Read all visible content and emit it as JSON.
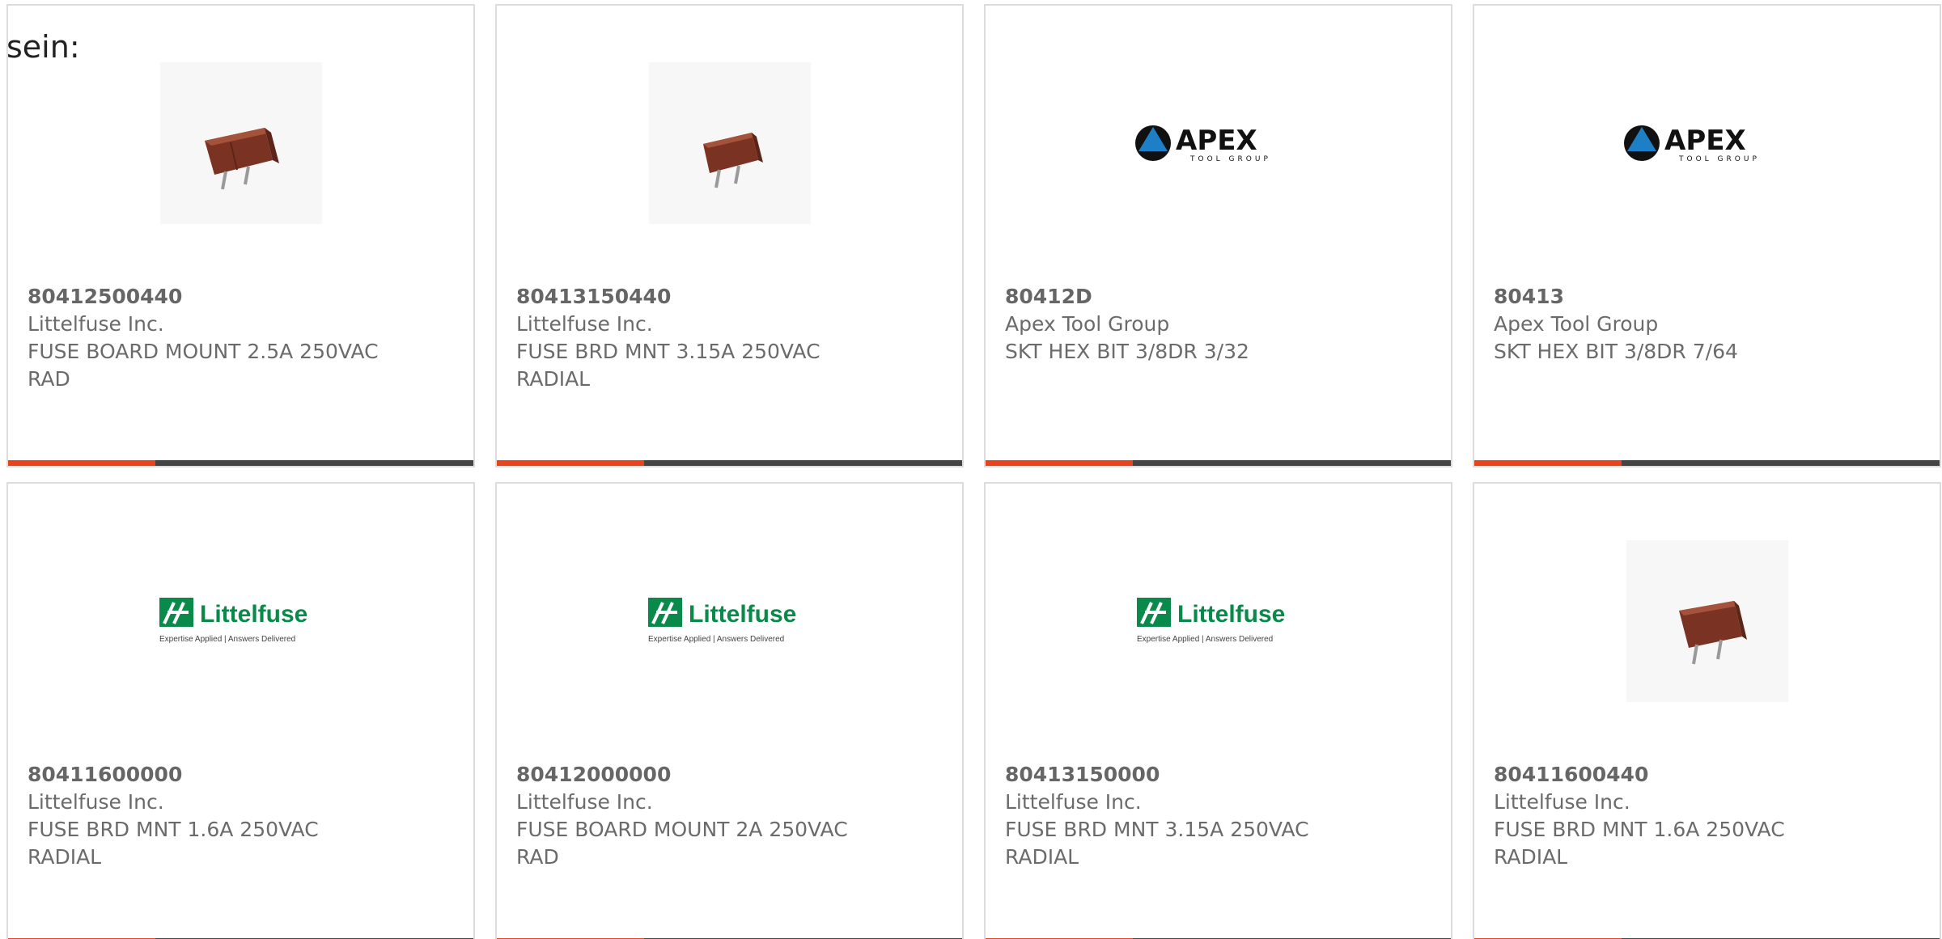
{
  "lead_text": "sein:",
  "colors": {
    "accent_bar": "#e8431b",
    "bar": "#444444",
    "fuse_body": "#8a3a28",
    "apex_blue": "#1d7fc6",
    "littelfuse_green": "#0a8a4a"
  },
  "products": [
    {
      "part_number": "80412500440",
      "manufacturer": "Littelfuse Inc.",
      "description": "FUSE BOARD MOUNT 2.5A 250VAC RAD",
      "image": "fuse-photo"
    },
    {
      "part_number": "80413150440",
      "manufacturer": "Littelfuse Inc.",
      "description": "FUSE BRD MNT 3.15A 250VAC RADIAL",
      "image": "fuse-photo"
    },
    {
      "part_number": "80412D",
      "manufacturer": "Apex Tool Group",
      "description": "SKT HEX BIT 3/8DR 3/32",
      "image": "apex-logo",
      "logo": {
        "name": "APEX",
        "sub": "TOOL GROUP"
      }
    },
    {
      "part_number": "80413",
      "manufacturer": "Apex Tool Group",
      "description": "SKT HEX BIT 3/8DR 7/64",
      "image": "apex-logo",
      "logo": {
        "name": "APEX",
        "sub": "TOOL GROUP"
      }
    },
    {
      "part_number": "80411600000",
      "manufacturer": "Littelfuse Inc.",
      "description": "FUSE BRD MNT 1.6A 250VAC RADIAL",
      "image": "littelfuse-logo",
      "logo": {
        "name": "Littelfuse",
        "tagline": "Expertise Applied | Answers Delivered"
      }
    },
    {
      "part_number": "80412000000",
      "manufacturer": "Littelfuse Inc.",
      "description": "FUSE BOARD MOUNT 2A 250VAC RAD",
      "image": "littelfuse-logo",
      "logo": {
        "name": "Littelfuse",
        "tagline": "Expertise Applied | Answers Delivered"
      }
    },
    {
      "part_number": "80413150000",
      "manufacturer": "Littelfuse Inc.",
      "description": "FUSE BRD MNT 3.15A 250VAC RADIAL",
      "image": "littelfuse-logo",
      "logo": {
        "name": "Littelfuse",
        "tagline": "Expertise Applied | Answers Delivered"
      }
    },
    {
      "part_number": "80411600440",
      "manufacturer": "Littelfuse Inc.",
      "description": "FUSE BRD MNT 1.6A 250VAC RADIAL",
      "image": "fuse-photo"
    }
  ]
}
